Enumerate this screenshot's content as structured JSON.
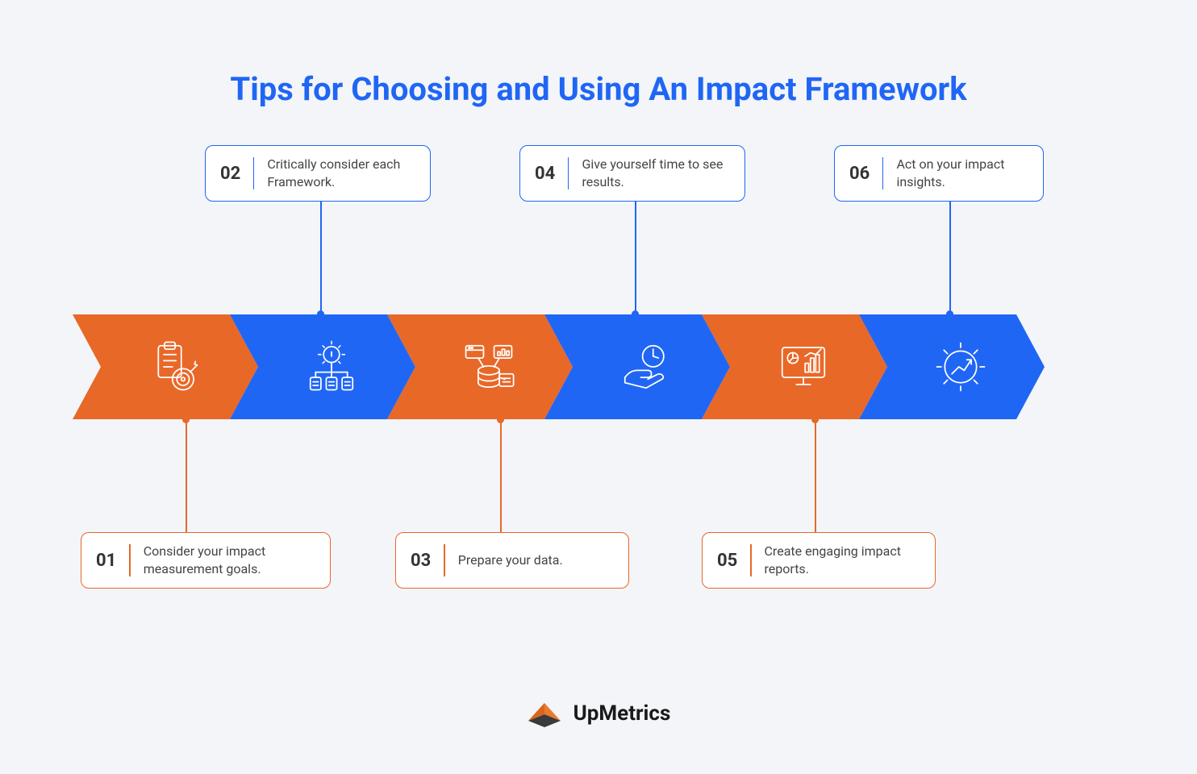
{
  "title": "Tips for Choosing and Using An Impact Framework",
  "colors": {
    "blue": "#2066F5",
    "orange": "#E86828",
    "background": "#F3F5F8"
  },
  "steps": [
    {
      "number": "01",
      "text": "Consider your impact measurement goals.",
      "color": "orange",
      "position": "bottom",
      "icon": "clipboard-target-icon"
    },
    {
      "number": "02",
      "text": "Critically consider each Framework.",
      "color": "blue",
      "position": "top",
      "icon": "gear-network-icon"
    },
    {
      "number": "03",
      "text": "Prepare your data.",
      "color": "orange",
      "position": "bottom",
      "icon": "database-icon"
    },
    {
      "number": "04",
      "text": "Give yourself time to see results.",
      "color": "blue",
      "position": "top",
      "icon": "hand-clock-icon"
    },
    {
      "number": "05",
      "text": "Create engaging impact reports.",
      "color": "orange",
      "position": "bottom",
      "icon": "monitor-chart-icon"
    },
    {
      "number": "06",
      "text": "Act on your impact insights.",
      "color": "blue",
      "position": "top",
      "icon": "gear-arrow-icon"
    }
  ],
  "footer": {
    "brand": "UpMetrics"
  }
}
